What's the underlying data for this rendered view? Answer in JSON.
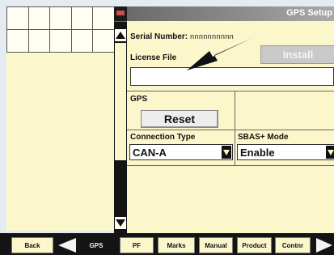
{
  "window": {
    "title": "GPS Setup"
  },
  "serial": {
    "label": "Serial Number:",
    "value": "nnnnnnnnnn"
  },
  "license": {
    "label": "License File",
    "value": "",
    "install_label": "Install"
  },
  "gps": {
    "section_label": "GPS",
    "reset_label": "Reset"
  },
  "connection": {
    "label": "Connection Type",
    "value": "CAN-A"
  },
  "sbas": {
    "label": "SBAS+ Mode",
    "value": "Enable"
  },
  "bottom_nav": {
    "back_label": "Back",
    "current_label": "GPS",
    "tabs": [
      "PF",
      "Marks",
      "Manual",
      "Product",
      "Contnr"
    ]
  },
  "colors": {
    "panel": "#fcf7cb",
    "bar": "#141414",
    "title_gradient_start": "#6a6a6a"
  },
  "icons": {
    "annotation": "arrow-annotation-icon",
    "scroll_up": "triangle-up-icon",
    "scroll_down": "triangle-down-icon"
  }
}
